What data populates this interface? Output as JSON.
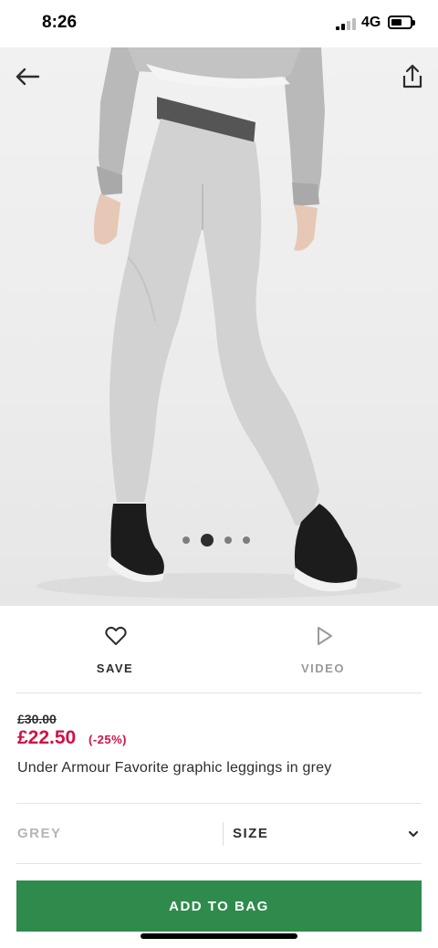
{
  "status_bar": {
    "time": "8:26",
    "network": "4G",
    "battery_fraction": 0.6
  },
  "gallery": {
    "image_count": 4,
    "active_index": 1,
    "image_alt": "Model wearing grey leggings, back view"
  },
  "actions": {
    "save_label": "SAVE",
    "video_label": "VIDEO"
  },
  "pricing": {
    "previous_price": "£30.00",
    "current_price": "£22.50",
    "discount": "(-25%)"
  },
  "product": {
    "title": "Under Armour Favorite graphic leggings in grey"
  },
  "options": {
    "colour": "GREY",
    "size_label": "SIZE"
  },
  "cta": {
    "add_to_bag_label": "ADD TO BAG"
  },
  "colors": {
    "accent_green": "#2f8b4c",
    "sale_red": "#d01345",
    "text": "#2d2d2d",
    "muted": "#b5b5b5"
  },
  "icons": [
    "back-arrow-icon",
    "share-icon",
    "heart-icon",
    "play-icon",
    "chevron-down-icon"
  ]
}
